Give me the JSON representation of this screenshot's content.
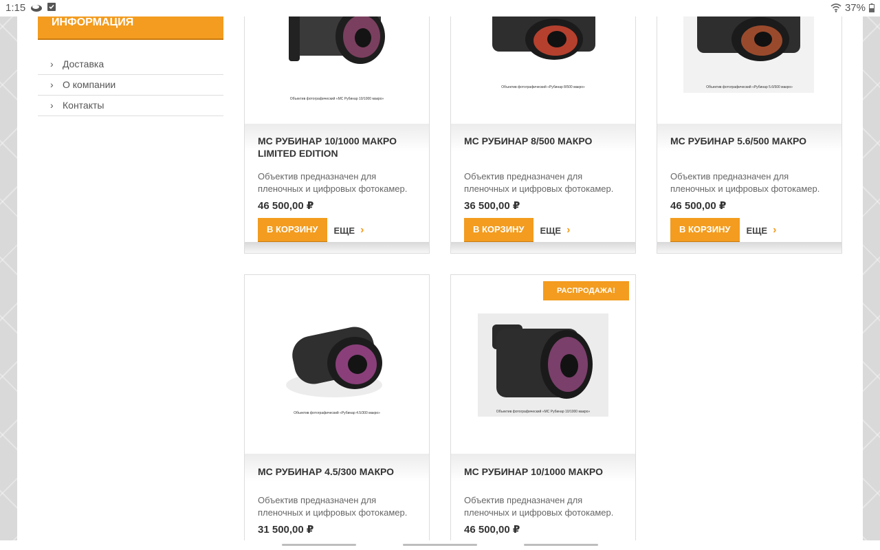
{
  "statusbar": {
    "time": "1:15",
    "battery": "37%"
  },
  "sidebar": {
    "header": "ИНФОРМАЦИЯ",
    "menu": [
      {
        "label": "Доставка"
      },
      {
        "label": "О компании"
      },
      {
        "label": "Контакты"
      }
    ]
  },
  "products": [
    {
      "title": "МС РУБИНАР 10/1000 МАКРО LIMITED EDITION",
      "desc": "Объектив предназначен для пленочных и цифровых фотокамер.",
      "price": "46 500,00 ₽",
      "cart_label": "В КОРЗИНУ",
      "more_label": "ЕЩЕ",
      "caption": "Объектив фотографический «МС Рубинар 10/1000 макро»"
    },
    {
      "title": "МС РУБИНАР 8/500 МАКРО",
      "desc": "Объектив предназначен для пленочных и цифровых фотокамер.",
      "price": "36 500,00 ₽",
      "cart_label": "В КОРЗИНУ",
      "more_label": "ЕЩЕ",
      "caption": "Объектив фотографический «Рубинар 8/500 макро»"
    },
    {
      "title": "МС РУБИНАР 5.6/500 МАКРО",
      "desc": "Объектив предназначен для пленочных и цифровых фотокамер.",
      "price": "46 500,00 ₽",
      "cart_label": "В КОРЗИНУ",
      "more_label": "ЕЩЕ",
      "caption": "Объектив фотографический «Рубинар 5.6/500 макро»"
    },
    {
      "title": "МС РУБИНАР 4.5/300 МАКРО",
      "desc": "Объектив предназначен для пленочных и цифровых фотокамер.",
      "price": "31 500,00 ₽",
      "caption": "Объектив фотографический «Рубинар 4.5/300 макро»"
    },
    {
      "title": "МС РУБИНАР 10/1000 МАКРО",
      "desc": "Объектив предназначен для пленочных и цифровых фотокамер.",
      "price": "46 500,00 ₽",
      "badge": "РАСПРОДАЖА!",
      "caption": "Объектив фотографический «МС Рубинар 10/1000 макро»"
    }
  ],
  "colors": {
    "accent": "#f39c1f",
    "accent_dark": "#c87a10"
  }
}
